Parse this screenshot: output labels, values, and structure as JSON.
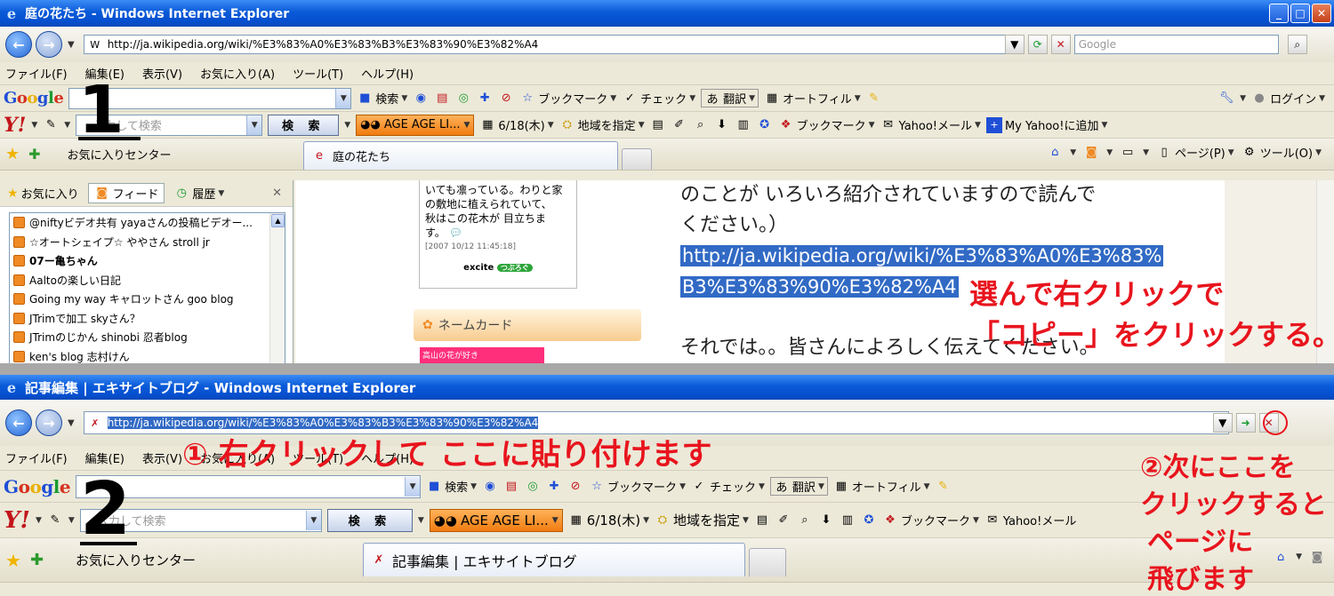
{
  "window1": {
    "title": "庭の花たち - Windows Internet Explorer",
    "address": "http://ja.wikipedia.org/wiki/%E3%83%A0%E3%83%B3%E3%83%90%E3%82%A4",
    "search_placeholder": "Google",
    "menu": [
      "ファイル(F)",
      "編集(E)",
      "表示(V)",
      "お気に入り(A)",
      "ツール(T)",
      "ヘルプ(H)"
    ],
    "google_bar": {
      "logo": "Google",
      "search_btn": "検索",
      "bookmark": "ブックマーク",
      "check": "チェック",
      "translate": "翻訳",
      "autofill": "オートフィル",
      "login": "ログイン"
    },
    "yahoo_bar": {
      "logo": "Y!",
      "placeholder": "入力して検索",
      "search_btn": "検 索",
      "age": "AGE AGE LI...",
      "date": "6/18(木)",
      "region": "地域を指定",
      "bookmark": "ブックマーク",
      "mail": "Yahoo!メール",
      "myyahoo": "My Yahoo!に追加"
    },
    "fav_center": "お気に入りセンター",
    "tab": "庭の花たち",
    "cmd": {
      "page": "ページ(P)",
      "tools": "ツール(O)"
    },
    "panel": {
      "tabs": [
        "お気に入り",
        "フィード",
        "履歴"
      ],
      "feeds": [
        {
          "label": "@niftyビデオ共有  yayaさんの投稿ビデオー...",
          "bold": false
        },
        {
          "label": "☆オートシェイプ☆  ややさん  stroll jr",
          "bold": false
        },
        {
          "label": "07ー亀ちゃん",
          "bold": true
        },
        {
          "label": "Aaltoの楽しい日記",
          "bold": false
        },
        {
          "label": "Going my way キャロットさん  goo blog",
          "bold": false
        },
        {
          "label": "JTrimで加工  skyさん？",
          "bold": false
        },
        {
          "label": "JTrimのじかん shinobi 忍者blog",
          "bold": false
        },
        {
          "label": "ken's blog  志村けん",
          "bold": false
        }
      ]
    },
    "blog": {
      "box_lines": [
        "いても凛っている。わりと家",
        "の敷地に植えられていて、",
        "秋はこの花木が  目立ちま",
        "す。"
      ],
      "box_date": "[2007 10/12 11:45:18]",
      "excite": "excite",
      "excite_pill": "つぶろぐ",
      "namecard": "ネームカード",
      "pink": "高山の花が好き",
      "line1": "のことが  いろいろ紹介されていますので読んで",
      "line2": "ください。）",
      "link1": "http://ja.wikipedia.org/wiki/%E3%83%A0%E3%83%",
      "link2": "B3%E3%83%90%E3%82%A4",
      "line3": "それでは。。皆さんによろしく伝えてください。"
    },
    "annot_number": "1",
    "annot_red1": "選んで右クリックで",
    "annot_red2": "「コピー」をクリックする。"
  },
  "window2": {
    "title": "記事編集 | エキサイトブログ - Windows Internet Explorer",
    "address": "http://ja.wikipedia.org/wiki/%E3%83%A0%E3%83%B3%E3%83%90%E3%82%A4",
    "menu": [
      "ファイル(F)",
      "編集(E)",
      "表示(V)",
      "お気に入り(A)",
      "ツール(T)",
      "ヘルプ(H)"
    ],
    "google_bar": {
      "logo": "Google",
      "search_btn": "検索",
      "bookmark": "ブックマーク",
      "check": "チェック",
      "translate": "翻訳",
      "autofill": "オートフィル"
    },
    "yahoo_bar": {
      "logo": "Y!",
      "placeholder": "入力して検索",
      "search_btn": "検 索",
      "age": "AGE AGE LI...",
      "date": "6/18(木)",
      "region": "地域を指定",
      "bookmark": "ブックマーク",
      "mail": "Yahoo!メール"
    },
    "fav_center": "お気に入りセンター",
    "tab": "記事編集 | エキサイトブログ",
    "annot_number": "2",
    "annot_red1": "① 右クリックして  ここに貼り付けます",
    "annot_red2_lines": [
      "②次にここを",
      "クリックすると",
      "ページに",
      "飛びます"
    ]
  },
  "colors": {
    "title_blue": "#0a5ad8",
    "selection": "#316ac5",
    "annotation_red": "#e8141d"
  }
}
